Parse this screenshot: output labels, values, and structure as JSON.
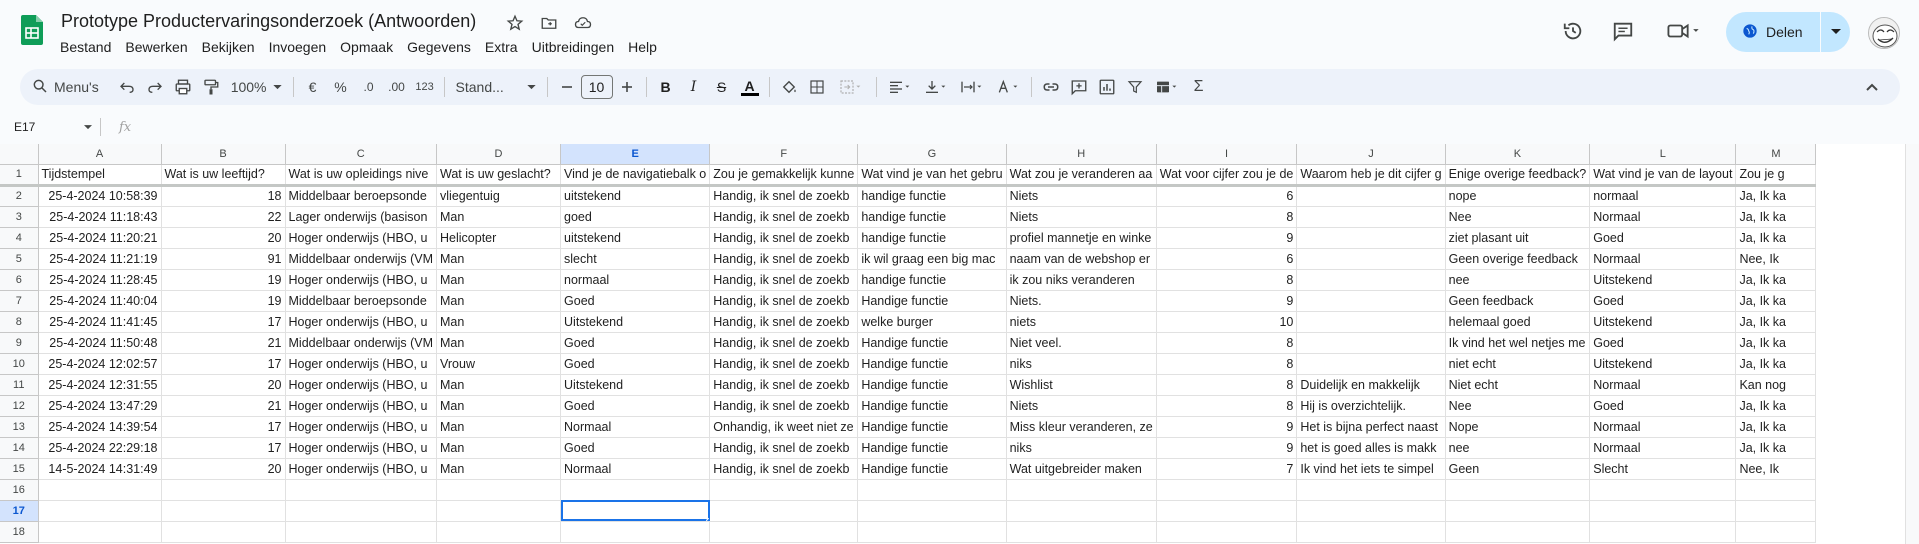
{
  "app": {
    "title": "Prototype Productervaringsonderzoek (Antwoorden)",
    "menu": [
      "Bestand",
      "Bewerken",
      "Bekijken",
      "Invoegen",
      "Opmaak",
      "Gegevens",
      "Extra",
      "Uitbreidingen",
      "Help"
    ],
    "share_label": "Delen",
    "accent": "#0b57d0",
    "share_bg": "#c2e7ff",
    "sheets_green": "#0f9d58"
  },
  "toolbar": {
    "search_label": "Menu's",
    "zoom": "100%",
    "currency": "€",
    "percent": "%",
    "dec_less": ".0",
    "dec_more": ".00",
    "number_format": "123",
    "font": "Stand...",
    "font_size": "10",
    "bold": "B",
    "italic": "I",
    "strike": "S",
    "text_color": "A"
  },
  "formula_bar": {
    "name_box": "E17",
    "fx": "fx",
    "content": ""
  },
  "sheet": {
    "columns": [
      "A",
      "B",
      "C",
      "D",
      "E",
      "F",
      "G",
      "H",
      "I",
      "J",
      "K",
      "L",
      "M"
    ],
    "selected_column": "E",
    "selected_row": "17",
    "header": [
      "Tijdstempel",
      "Wat is uw leeftijd?",
      "Wat is uw opleidings nive",
      "Wat is uw geslacht?",
      "Vind je de navigatiebalk o",
      "Zou je gemakkelijk kunne",
      "Wat vind je van het gebru",
      "Wat zou je veranderen aa",
      "Wat voor cijfer zou je de",
      "Waarom heb je dit cijfer g",
      "Enige overige feedback?",
      "Wat vind je van de layout",
      "Zou je g"
    ],
    "rows": [
      [
        "2",
        "25-4-2024 10:58:39",
        "18",
        "Middelbaar beroepsonde",
        "vliegentuig",
        "uitstekend",
        "Handig,  ik snel de zoekb",
        "handige functie",
        "Niets",
        "6",
        "",
        "nope",
        "normaal",
        "Ja, Ik ka"
      ],
      [
        "3",
        "25-4-2024 11:18:43",
        "22",
        "Lager onderwijs (basison",
        "Man",
        "goed",
        "Handig,  ik snel de zoekb",
        "handige functie",
        "Niets",
        "8",
        "",
        "Nee",
        "Normaal",
        "Ja, Ik ka"
      ],
      [
        "4",
        "25-4-2024 11:20:21",
        "20",
        "Hoger onderwijs (HBO, u",
        "Helicopter",
        "uitstekend",
        "Handig,  ik snel de zoekb",
        "handige functie",
        "profiel mannetje en winke",
        "9",
        "",
        "ziet plasant uit",
        "Goed",
        "Ja, Ik ka"
      ],
      [
        "5",
        "25-4-2024 11:21:19",
        "91",
        "Middelbaar onderwijs (VM",
        "Man",
        "slecht",
        "Handig,  ik snel de zoekb",
        "ik wil graag een big mac",
        "naam van de webshop er",
        "6",
        "",
        "Geen overige feedback",
        "Normaal",
        "Nee, Ik"
      ],
      [
        "6",
        "25-4-2024 11:28:45",
        "19",
        "Hoger onderwijs (HBO, u",
        "Man",
        "normaal",
        "Handig,  ik snel de zoekb",
        "handige functie",
        "ik zou niks veranderen",
        "8",
        "",
        "nee",
        "Uitstekend",
        "Ja, Ik ka"
      ],
      [
        "7",
        "25-4-2024 11:40:04",
        "19",
        "Middelbaar beroepsonde",
        "Man",
        "Goed",
        "Handig,  ik snel de zoekb",
        "Handige functie",
        "Niets.",
        "9",
        "",
        "Geen feedback",
        "Goed",
        "Ja, Ik ka"
      ],
      [
        "8",
        "25-4-2024 11:41:45",
        "17",
        "Hoger onderwijs (HBO, u",
        "Man",
        "Uitstekend",
        "Handig,  ik snel de zoekb",
        "welke burger",
        "niets",
        "10",
        "",
        "helemaal goed",
        "Uitstekend",
        "Ja, Ik ka"
      ],
      [
        "9",
        "25-4-2024 11:50:48",
        "21",
        "Middelbaar onderwijs (VM",
        "Man",
        "Goed",
        "Handig,  ik snel de zoekb",
        "Handige functie",
        "Niet veel.",
        "8",
        "",
        "Ik vind het wel netjes me",
        "Goed",
        "Ja, Ik ka"
      ],
      [
        "10",
        "25-4-2024 12:02:57",
        "17",
        "Hoger onderwijs (HBO, u",
        "Vrouw",
        "Goed",
        "Handig,  ik snel de zoekb",
        "Handige functie",
        "niks",
        "8",
        "",
        "niet echt",
        "Uitstekend",
        "Ja, Ik ka"
      ],
      [
        "11",
        "25-4-2024 12:31:55",
        "20",
        "Hoger onderwijs (HBO, u",
        "Man",
        "Uitstekend",
        "Handig,  ik snel de zoekb",
        "Handige functie",
        "Wishlist",
        "8",
        "Duidelijk en makkelijk",
        "Niet echt",
        "Normaal",
        "Kan nog"
      ],
      [
        "12",
        "25-4-2024 13:47:29",
        "21",
        "Hoger onderwijs (HBO, u",
        "Man",
        "Goed",
        "Handig,  ik snel de zoekb",
        "Handige functie",
        "Niets",
        "8",
        "Hij is overzichtelijk.",
        "Nee",
        "Goed",
        "Ja, Ik ka"
      ],
      [
        "13",
        "25-4-2024 14:39:54",
        "17",
        "Hoger onderwijs (HBO, u",
        "Man",
        "Normaal",
        "Onhandig, ik weet niet ze",
        "Handige functie",
        "Miss kleur veranderen, ze",
        "9",
        "Het is bijna perfect naast",
        "Nope",
        "Normaal",
        "Ja, Ik ka"
      ],
      [
        "14",
        "25-4-2024 22:29:18",
        "17",
        "Hoger onderwijs (HBO, u",
        "Man",
        "Goed",
        "Handig,  ik snel de zoekb",
        "Handige functie",
        "niks",
        "9",
        "het is goed alles is makk",
        "nee",
        "Normaal",
        "Ja, Ik ka"
      ],
      [
        "15",
        "14-5-2024 14:31:49",
        "20",
        "Hoger onderwijs (HBO, u",
        "Man",
        "Normaal",
        "Handig,  ik snel de zoekb",
        "Handige functie",
        "Wat uitgebreider maken",
        "7",
        "Ik vind het iets te simpel",
        "Geen",
        "Slecht",
        "Nee, Ik"
      ]
    ],
    "empty_rows": [
      "16",
      "17",
      "18"
    ]
  }
}
